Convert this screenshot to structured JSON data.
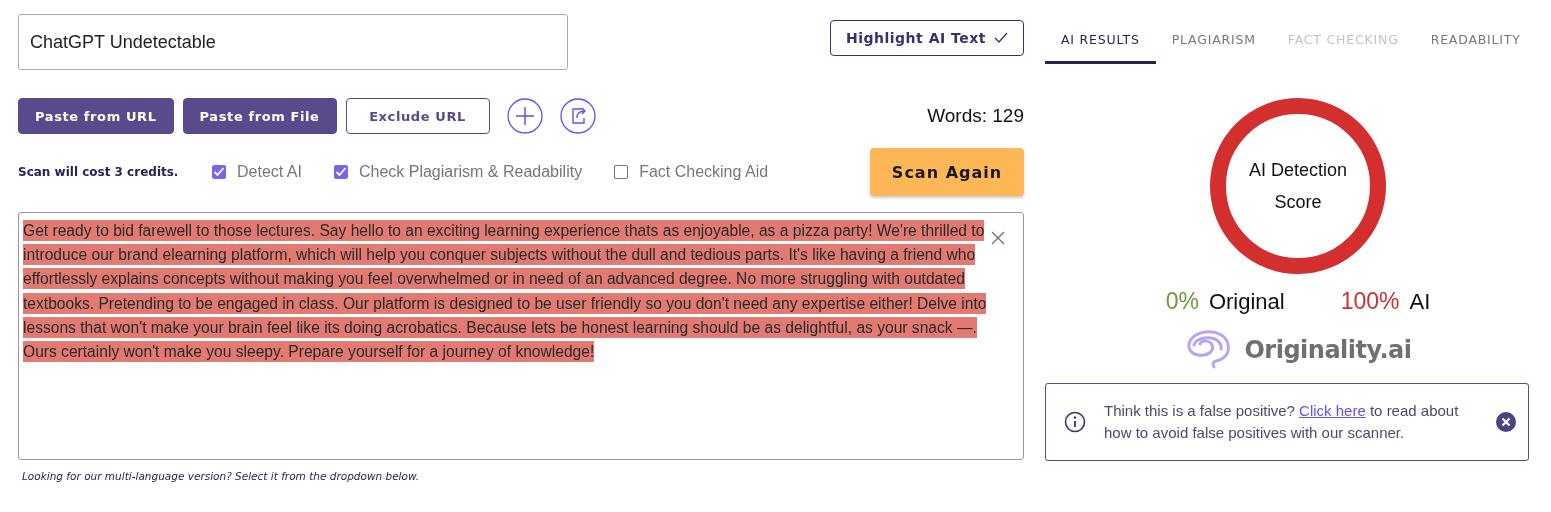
{
  "title_field": {
    "value": "ChatGPT Undetectable"
  },
  "highlight_button": {
    "label": "Highlight AI Text",
    "checked": true
  },
  "toolbar": [
    {
      "kind": "filled",
      "label": "Paste from URL"
    },
    {
      "kind": "filled",
      "label": "Paste from File"
    },
    {
      "kind": "outline",
      "label": "Exclude URL"
    },
    {
      "kind": "add"
    },
    {
      "kind": "share"
    }
  ],
  "word_count": "Words: 129",
  "cost_note": "Scan will cost 3 credits.",
  "options": [
    {
      "label": "Detect AI",
      "checked": true
    },
    {
      "label": "Check Plagiarism & Readability",
      "checked": true
    },
    {
      "label": "Fact Checking Aid",
      "checked": false
    }
  ],
  "scan_button": "Scan Again",
  "editor": {
    "text": "Get ready to bid farewell to those lectures. Say hello to an exciting learning experience thats as enjoyable, as a pizza party! We're thrilled to introduce our brand elearning platform, which will help you conquer subjects without the dull and tedious parts. It's like having a friend who effortlessly explains concepts without making you feel overwhelmed or in need of an advanced degree. No more struggling with outdated textbooks. Pretending to be engaged in class. Our platform is designed to be user friendly so you don't need any expertise either! Delve into lessons that won't make your brain feel like its doing acrobatics. Because lets be honest learning should be as delightful, as your snack —. Ours certainly won't make you sleepy. Prepare yourself for a journey of knowledge!",
    "highlighted": true
  },
  "language_note": "Looking for our multi-language version? Select it from the dropdown below.",
  "tabs": [
    {
      "label": "AI RESULTS",
      "selected": true,
      "disabled": false
    },
    {
      "label": "PLAGIARISM",
      "selected": false,
      "disabled": false
    },
    {
      "label": "FACT CHECKING",
      "selected": false,
      "disabled": true
    },
    {
      "label": "READABILITY",
      "selected": false,
      "disabled": false
    }
  ],
  "score": {
    "label": "AI Detection Score"
  },
  "results": [
    {
      "value": "0%",
      "label": "Original",
      "color": "#6a9a3a"
    },
    {
      "value": "100%",
      "label": "AI",
      "color": "#d03030"
    }
  ],
  "logo": {
    "text": "Originality.ai"
  },
  "alert": {
    "before": "Think this is a false positive?",
    "link": "Click here",
    "after": "to read about how to avoid false positives with our scanner."
  }
}
